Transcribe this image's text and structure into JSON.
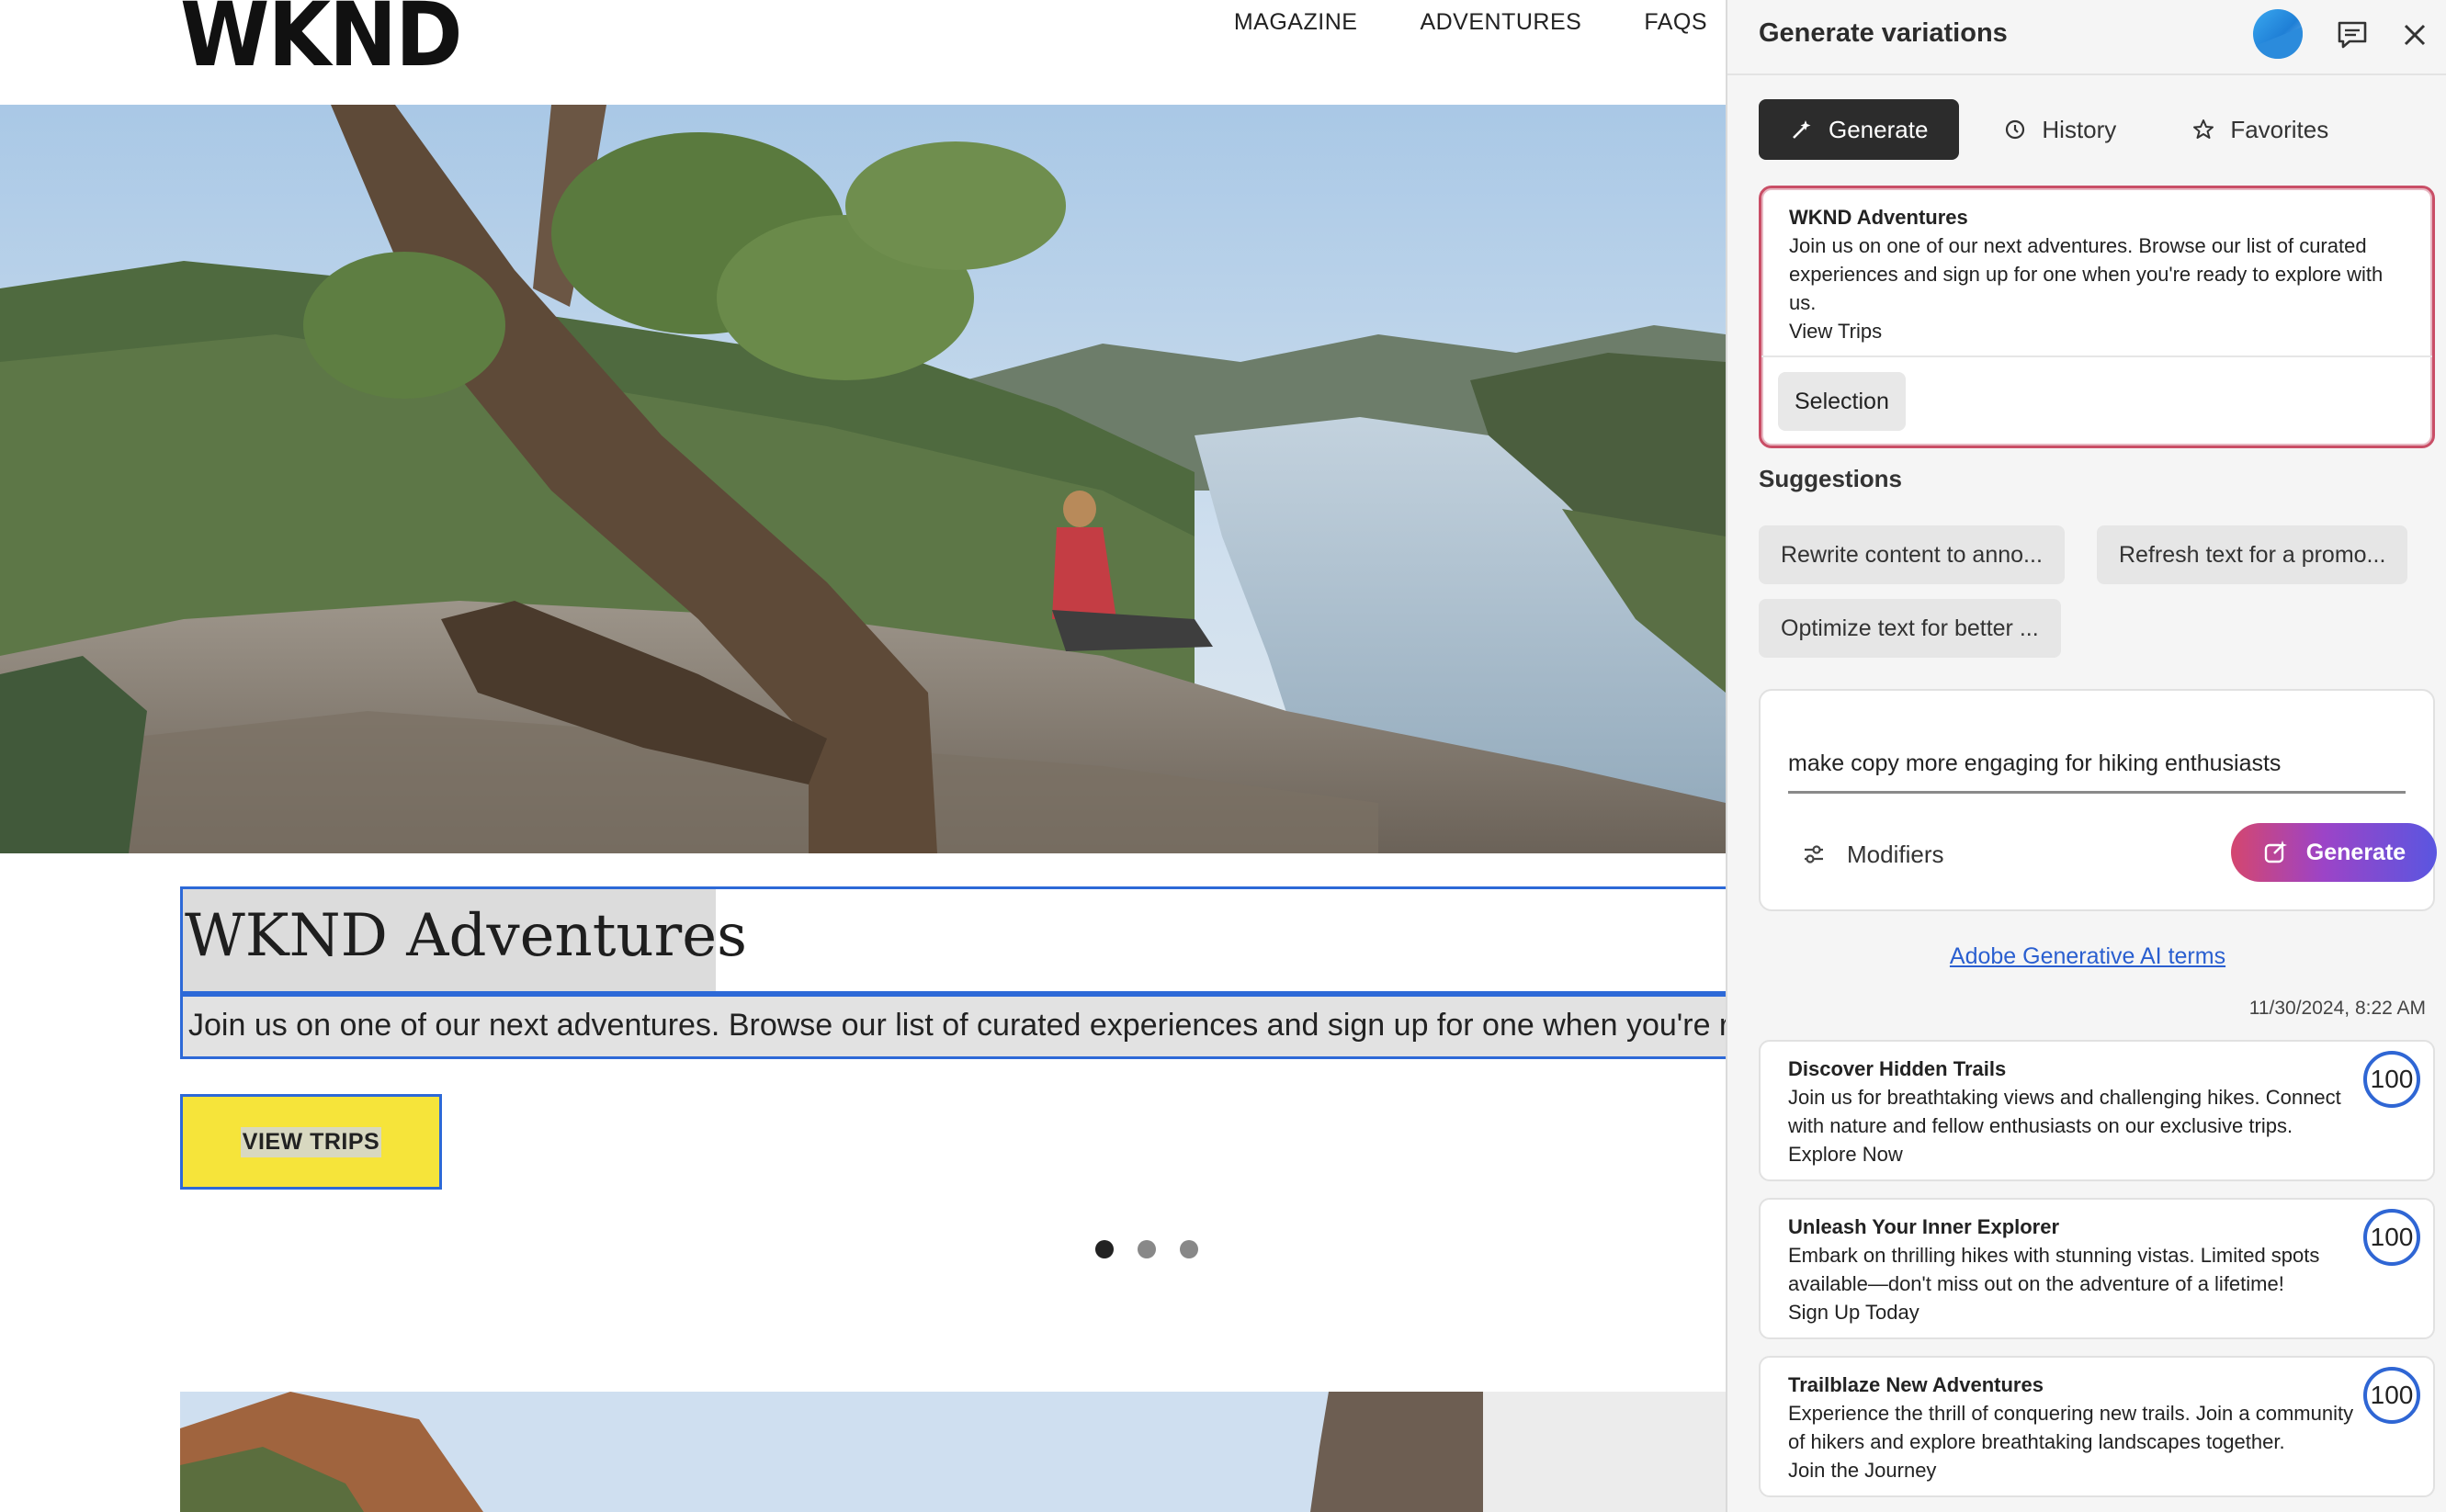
{
  "site": {
    "logo": "WKND",
    "nav": [
      "MAGAZINE",
      "ADVENTURES",
      "FAQS"
    ],
    "hero": {
      "title": "WKND Adventures",
      "description": "Join us on one of our next adventures. Browse our list of curated experiences and sign up for one when you're rea",
      "cta": "VIEW TRIPS"
    },
    "carousel": {
      "slides": 3,
      "active": 1
    }
  },
  "panel": {
    "title": "Generate variations",
    "tabs": [
      {
        "label": "Generate",
        "icon": "generate-icon",
        "active": true
      },
      {
        "label": "History",
        "icon": "history-icon",
        "active": false
      },
      {
        "label": "Favorites",
        "icon": "star-icon",
        "active": false
      }
    ],
    "context": {
      "title": "WKND Adventures",
      "body": "Join us on one of our next adventures. Browse our list of curated experiences and sign up for one when you're ready to explore with us.",
      "cta": "View Trips",
      "chip": "Selection"
    },
    "suggestions_label": "Suggestions",
    "suggestions": [
      "Rewrite content to anno...",
      "Refresh text for a promo...",
      "Optimize text for better ..."
    ],
    "prompt": {
      "value": "make copy more engaging for hiking enthusiasts",
      "modifiers_label": "Modifiers",
      "generate_label": "Generate"
    },
    "terms_link": "Adobe Generative AI terms",
    "timestamp": "11/30/2024, 8:22 AM",
    "results": [
      {
        "title": "Discover Hidden Trails",
        "body": "Join us for breathtaking views and challenging hikes. Connect with nature and fellow enthusiasts on our exclusive trips.",
        "cta": "Explore Now",
        "score": "100"
      },
      {
        "title": "Unleash Your Inner Explorer",
        "body": "Embark on thrilling hikes with stunning vistas. Limited spots available—don't miss out on the adventure of a lifetime!",
        "cta": "Sign Up Today",
        "score": "100"
      },
      {
        "title": "Trailblaze New Adventures",
        "body": "Experience the thrill of conquering new trails. Join a community of hikers and explore breathtaking landscapes together.",
        "cta": "Join the Journey",
        "score": "100"
      }
    ],
    "colors": {
      "selection_border": "#c94e66",
      "score_ring": "#2f66d4",
      "link": "#2a5fd0",
      "cta_yellow": "#f6e43a",
      "edit_outline": "#2d69d7"
    }
  }
}
